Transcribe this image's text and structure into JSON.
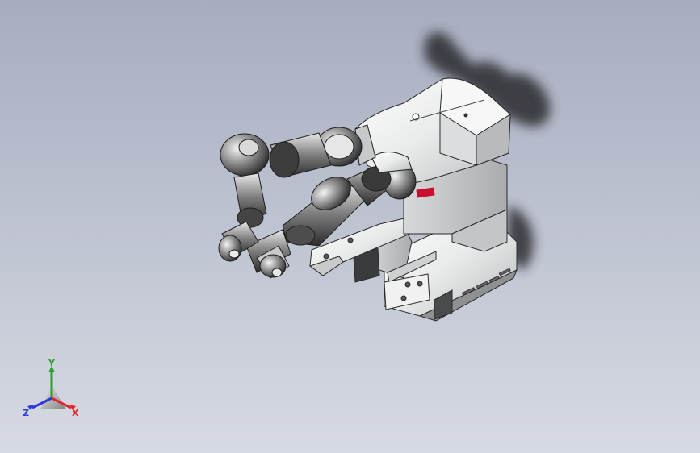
{
  "viewport": {
    "background_top": "#a7adbf",
    "background_bottom": "#d7dae2"
  },
  "model": {
    "icon": "dual-arm-robot-model",
    "logo_color": "#c8102e"
  },
  "triad": {
    "x_label": "X",
    "y_label": "Y",
    "z_label": "Z",
    "x_color": "#e0262a",
    "y_color": "#2aa12a",
    "z_color": "#2a3ad6"
  }
}
